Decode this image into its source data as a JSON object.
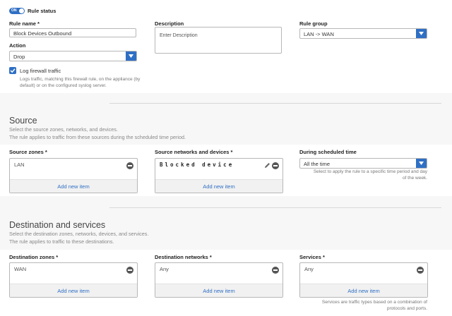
{
  "rule": {
    "status_toggle": "ON",
    "status_label": "Rule status",
    "name_label": "Rule name *",
    "name_value": "Block Devices Outbound",
    "description_label": "Description",
    "description_placeholder": "Enter Description",
    "group_label": "Rule group",
    "group_value": "LAN -> WAN",
    "action_label": "Action",
    "action_value": "Drop",
    "log_label": "Log firewall traffic",
    "log_checked": true,
    "log_help": "Logs traffic, matching this firewall rule, on the appliance (by default) or on the configured syslog server."
  },
  "source": {
    "title": "Source",
    "desc1": "Select the source zones, networks, and devices.",
    "desc2": "The rule applies to traffic from these sources during the scheduled time period.",
    "zones_label": "Source zones *",
    "zones_item": "LAN",
    "zones_add": "Add new item",
    "networks_label": "Source networks and devices *",
    "networks_item": "Blocked device",
    "networks_add": "Add new item",
    "schedule_label": "During scheduled time",
    "schedule_value": "All the time",
    "schedule_help": "Select to apply the rule to a specific time period and day of the week."
  },
  "destination": {
    "title": "Destination and services",
    "desc1": "Select the destination zones, networks, devices, and services.",
    "desc2": "The rule applies to traffic to these destinations.",
    "zones_label": "Destination zones *",
    "zones_item": "WAN",
    "zones_add": "Add new item",
    "networks_label": "Destination networks *",
    "networks_item": "Any",
    "networks_add": "Add new item",
    "services_label": "Services *",
    "services_item": "Any",
    "services_add": "Add new item",
    "services_help": "Services are traffic types based on a combination of protocols and ports."
  },
  "colors": {
    "accent": "#2f6fc4",
    "link": "#2f6fc4"
  }
}
